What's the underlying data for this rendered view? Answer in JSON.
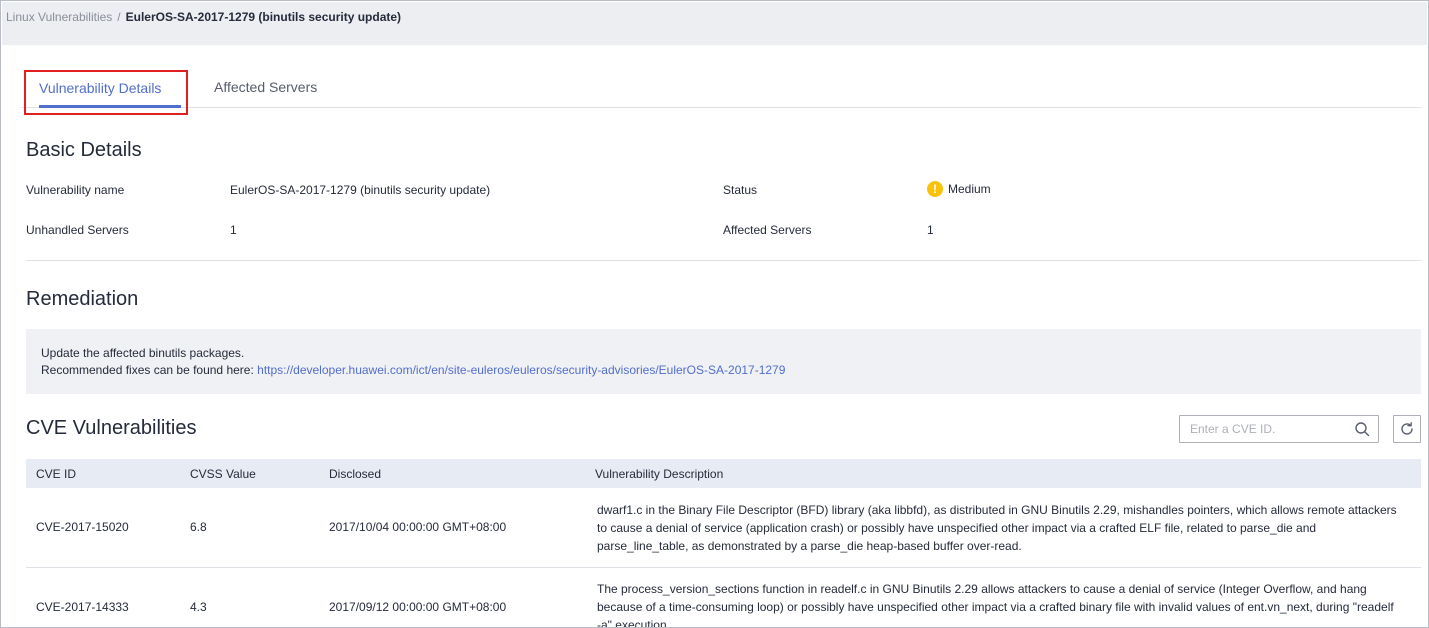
{
  "breadcrumb": {
    "parent": "Linux Vulnerabilities",
    "separator": "/",
    "current": "EulerOS-SA-2017-1279 (binutils security update)"
  },
  "tabs": [
    {
      "label": "Vulnerability Details",
      "active": true
    },
    {
      "label": "Affected Servers",
      "active": false
    }
  ],
  "basic_details": {
    "title": "Basic Details",
    "vulnerability_name_label": "Vulnerability name",
    "vulnerability_name_value": "EulerOS-SA-2017-1279 (binutils security update)",
    "status_label": "Status",
    "status_value": "Medium",
    "status_icon": "warning-icon",
    "status_color": "#fac20a",
    "unhandled_label": "Unhandled Servers",
    "unhandled_value": "1",
    "affected_label": "Affected Servers",
    "affected_value": "1"
  },
  "remediation": {
    "title": "Remediation",
    "line1": "Update the affected binutils packages.",
    "line2_prefix": "Recommended fixes can be found here: ",
    "link": "https://developer.huawei.com/ict/en/site-euleros/euleros/security-advisories/EulerOS-SA-2017-1279"
  },
  "cve": {
    "title": "CVE Vulnerabilities",
    "search_placeholder": "Enter a CVE ID.",
    "columns": [
      "CVE ID",
      "CVSS Value",
      "Disclosed",
      "Vulnerability Description"
    ],
    "rows": [
      {
        "id": "CVE-2017-15020",
        "cvss": "6.8",
        "disclosed": "2017/10/04 00:00:00 GMT+08:00",
        "description": "dwarf1.c in the Binary File Descriptor (BFD) library (aka libbfd), as distributed in GNU Binutils 2.29, mishandles pointers, which allows remote attackers to cause a denial of service (application crash) or possibly have unspecified other impact via a crafted ELF file, related to parse_die and parse_line_table, as demonstrated by a parse_die heap-based buffer over-read."
      },
      {
        "id": "CVE-2017-14333",
        "cvss": "4.3",
        "disclosed": "2017/09/12 00:00:00 GMT+08:00",
        "description": "The process_version_sections function in readelf.c in GNU Binutils 2.29 allows attackers to cause a denial of service (Integer Overflow, and hang because of a time-consuming loop) or possibly have unspecified other impact via a crafted binary file with invalid values of ent.vn_next, during \"readelf -a\" execution."
      }
    ]
  },
  "colors": {
    "accent": "#526ecc",
    "highlight_border": "#e02020",
    "table_header_bg": "#e6ebf4",
    "topbar_bg": "#eceef2"
  }
}
